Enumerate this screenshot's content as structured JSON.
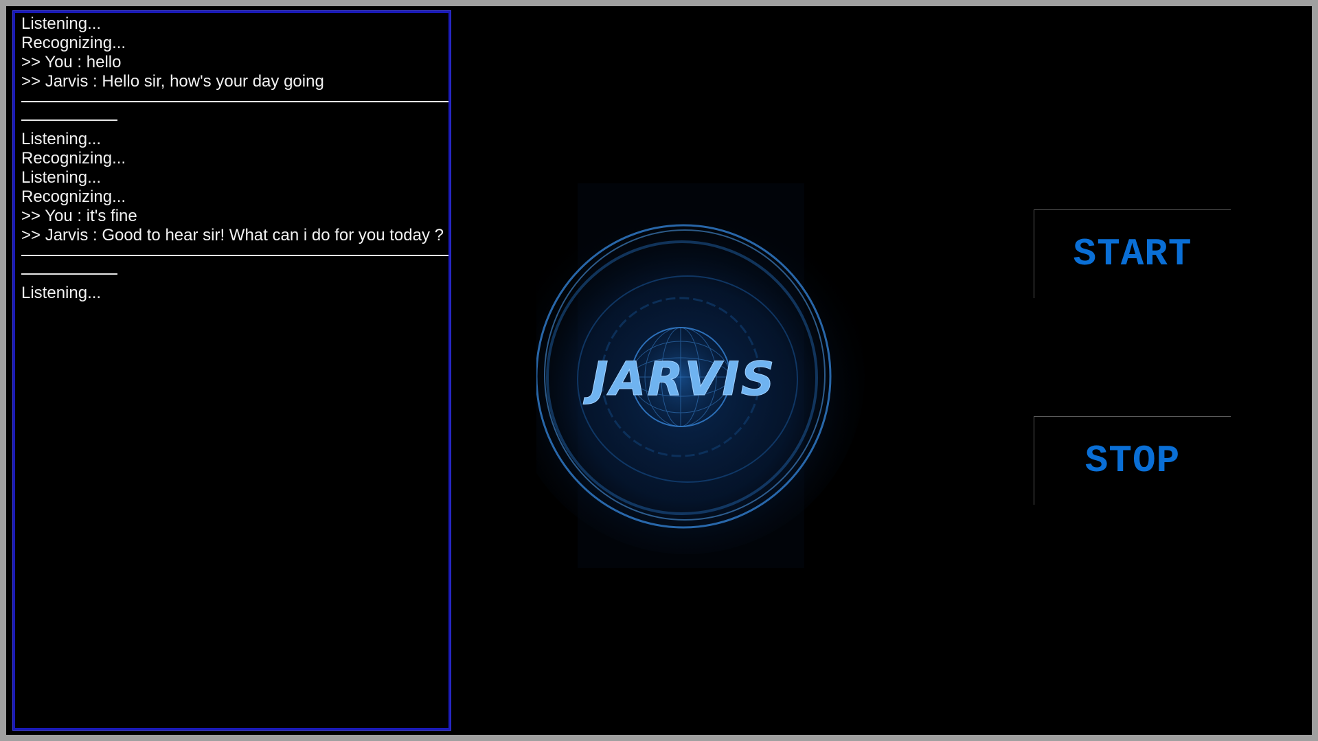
{
  "log": {
    "blocks": [
      {
        "lines": [
          "Listening...",
          "Recognizing...",
          ">> You : hello",
          ">> Jarvis : Hello sir, how's your day going"
        ]
      },
      {
        "lines": [
          "Listening...",
          "Recognizing...",
          "Listening...",
          "Recognizing...",
          ">> You : it's fine",
          ">> Jarvis : Good to hear sir! What can i do for you today ?"
        ]
      },
      {
        "lines": [
          "Listening..."
        ]
      }
    ]
  },
  "logo": {
    "text": "JARVIS",
    "icon": "jarvis-orb-logo"
  },
  "controls": {
    "start_label": "START",
    "stop_label": "STOP"
  },
  "colors": {
    "accent": "#0a6fd6",
    "panel_border": "#1a1ab8",
    "text": "#f2f2f2",
    "background": "#000000",
    "window_frame": "#a0a0a0"
  }
}
